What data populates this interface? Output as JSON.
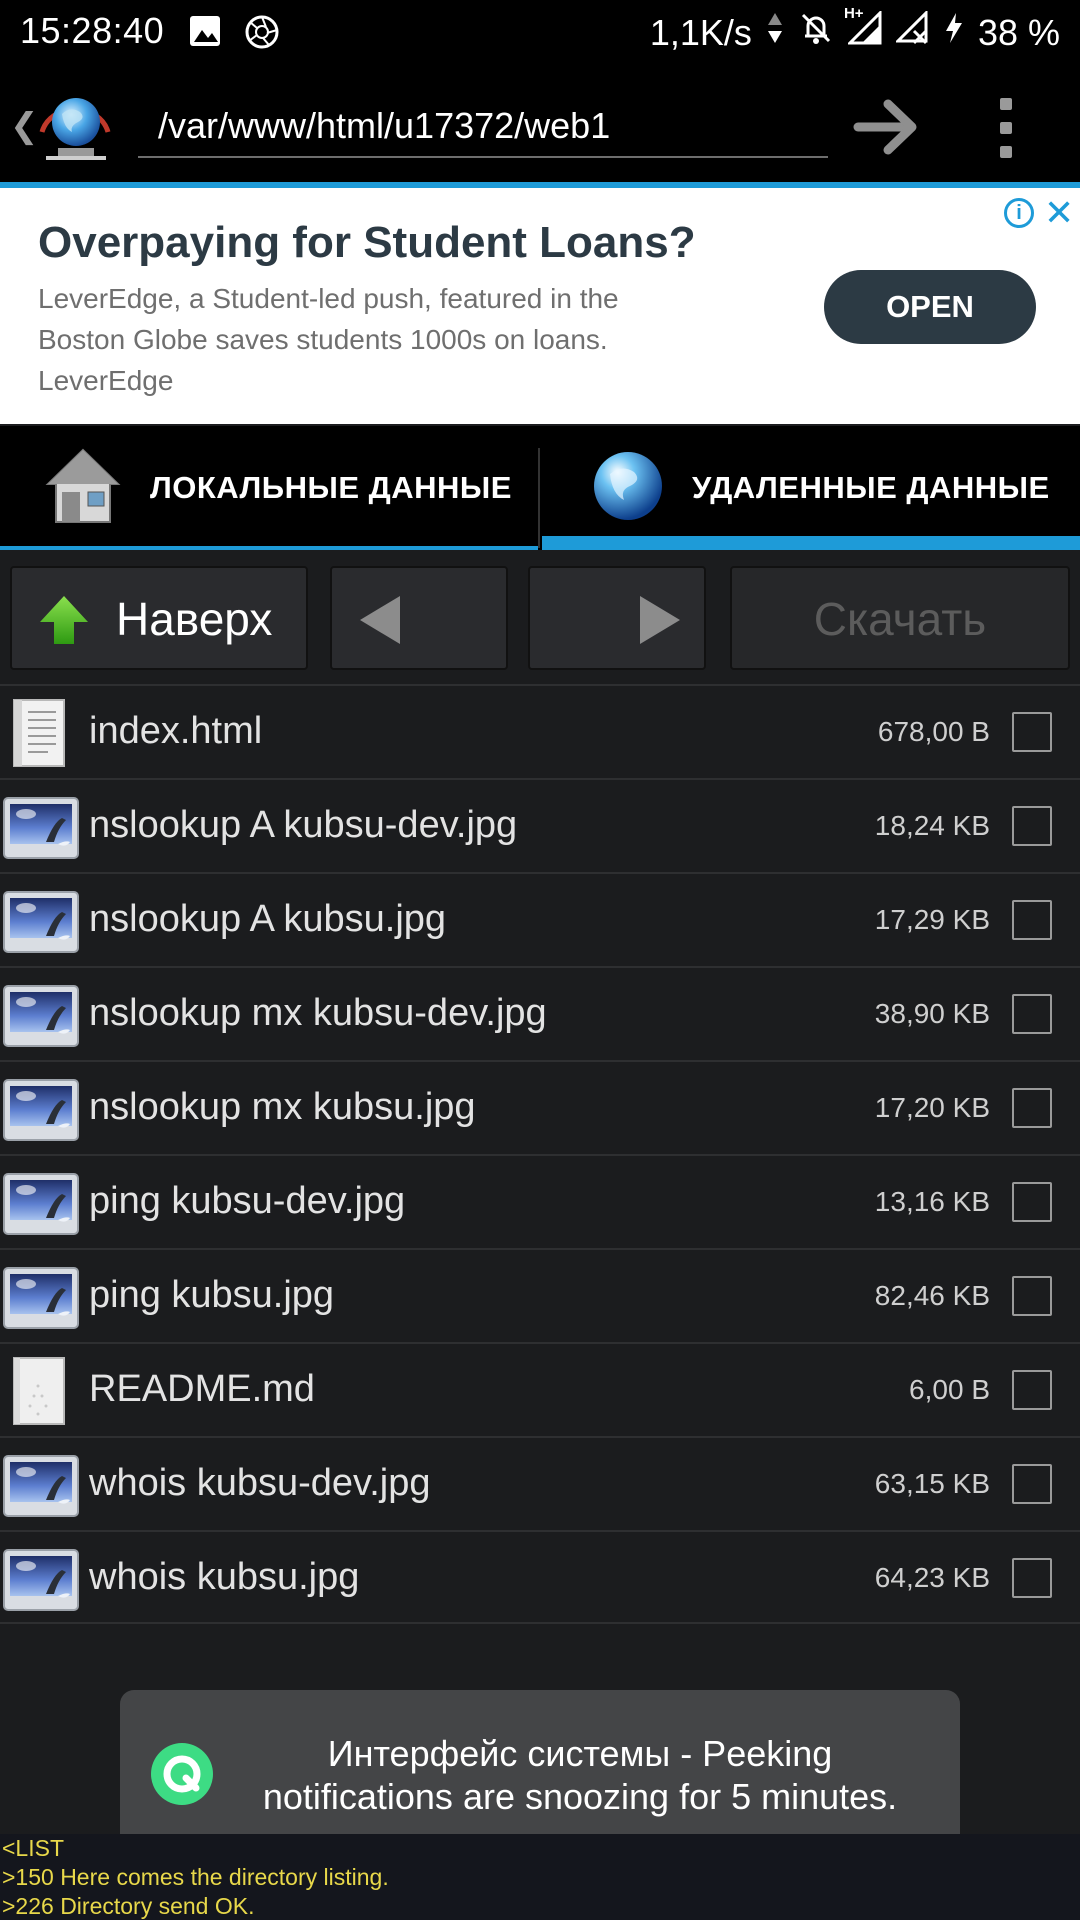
{
  "status_bar": {
    "time": "15:28:40",
    "net_speed": "1,1K/s",
    "network_type": "H+",
    "battery": "38 %",
    "icons": [
      "image-icon",
      "aperture-icon",
      "data-activity-icon",
      "bell-off-icon",
      "signal-icon",
      "signal-no-sim-icon",
      "charging-icon"
    ]
  },
  "address_bar": {
    "path": "/var/www/html/u17372/web1",
    "icons": [
      "back-chevron-icon",
      "globe-logo-icon",
      "go-arrow-icon",
      "overflow-menu-icon"
    ]
  },
  "ad": {
    "title": "Overpaying for Student Loans?",
    "text": "LeverEdge, a Student-led push, featured in the Boston Globe saves students 1000s on loans.",
    "advertiser": "LeverEdge",
    "button": "OPEN",
    "info_icon": "i",
    "close_icon": "✕"
  },
  "tabs": [
    {
      "label": "ЛОКАЛЬНЫЕ ДАННЫЕ",
      "icon": "house-icon",
      "active": false
    },
    {
      "label": "УДАЛЕННЫЕ ДАННЫЕ",
      "icon": "globe-icon",
      "active": true
    }
  ],
  "toolbar": {
    "up_label": "Наверх",
    "download_label": "Скачать"
  },
  "files": [
    {
      "name": "index.html",
      "size": "678,00 B",
      "type": "document"
    },
    {
      "name": "nslookup A kubsu-dev.jpg",
      "size": "18,24 KB",
      "type": "image"
    },
    {
      "name": "nslookup A kubsu.jpg",
      "size": "17,29 KB",
      "type": "image"
    },
    {
      "name": "nslookup mx kubsu-dev.jpg",
      "size": "38,90 KB",
      "type": "image"
    },
    {
      "name": "nslookup mx kubsu.jpg",
      "size": "17,20 KB",
      "type": "image"
    },
    {
      "name": "ping kubsu-dev.jpg",
      "size": "13,16 KB",
      "type": "image"
    },
    {
      "name": "ping kubsu.jpg",
      "size": "82,46 KB",
      "type": "image"
    },
    {
      "name": "README.md",
      "size": "6,00 B",
      "type": "blank-document"
    },
    {
      "name": "whois kubsu-dev.jpg",
      "size": "63,15 KB",
      "type": "image"
    },
    {
      "name": "whois kubsu.jpg",
      "size": "64,23 KB",
      "type": "image"
    }
  ],
  "toast": {
    "text": "Интерфейс системы - Peeking notifications are snoozing for 5 minutes."
  },
  "log": [
    "<LIST",
    ">150 Here comes the directory listing.",
    ">226 Directory send OK."
  ],
  "colors": {
    "accent": "#1e9bd8",
    "background": "#1b1c1e",
    "ad_button": "#2c3a44",
    "log_text": "#e8d84a",
    "toast_icon": "#3ddc84"
  }
}
